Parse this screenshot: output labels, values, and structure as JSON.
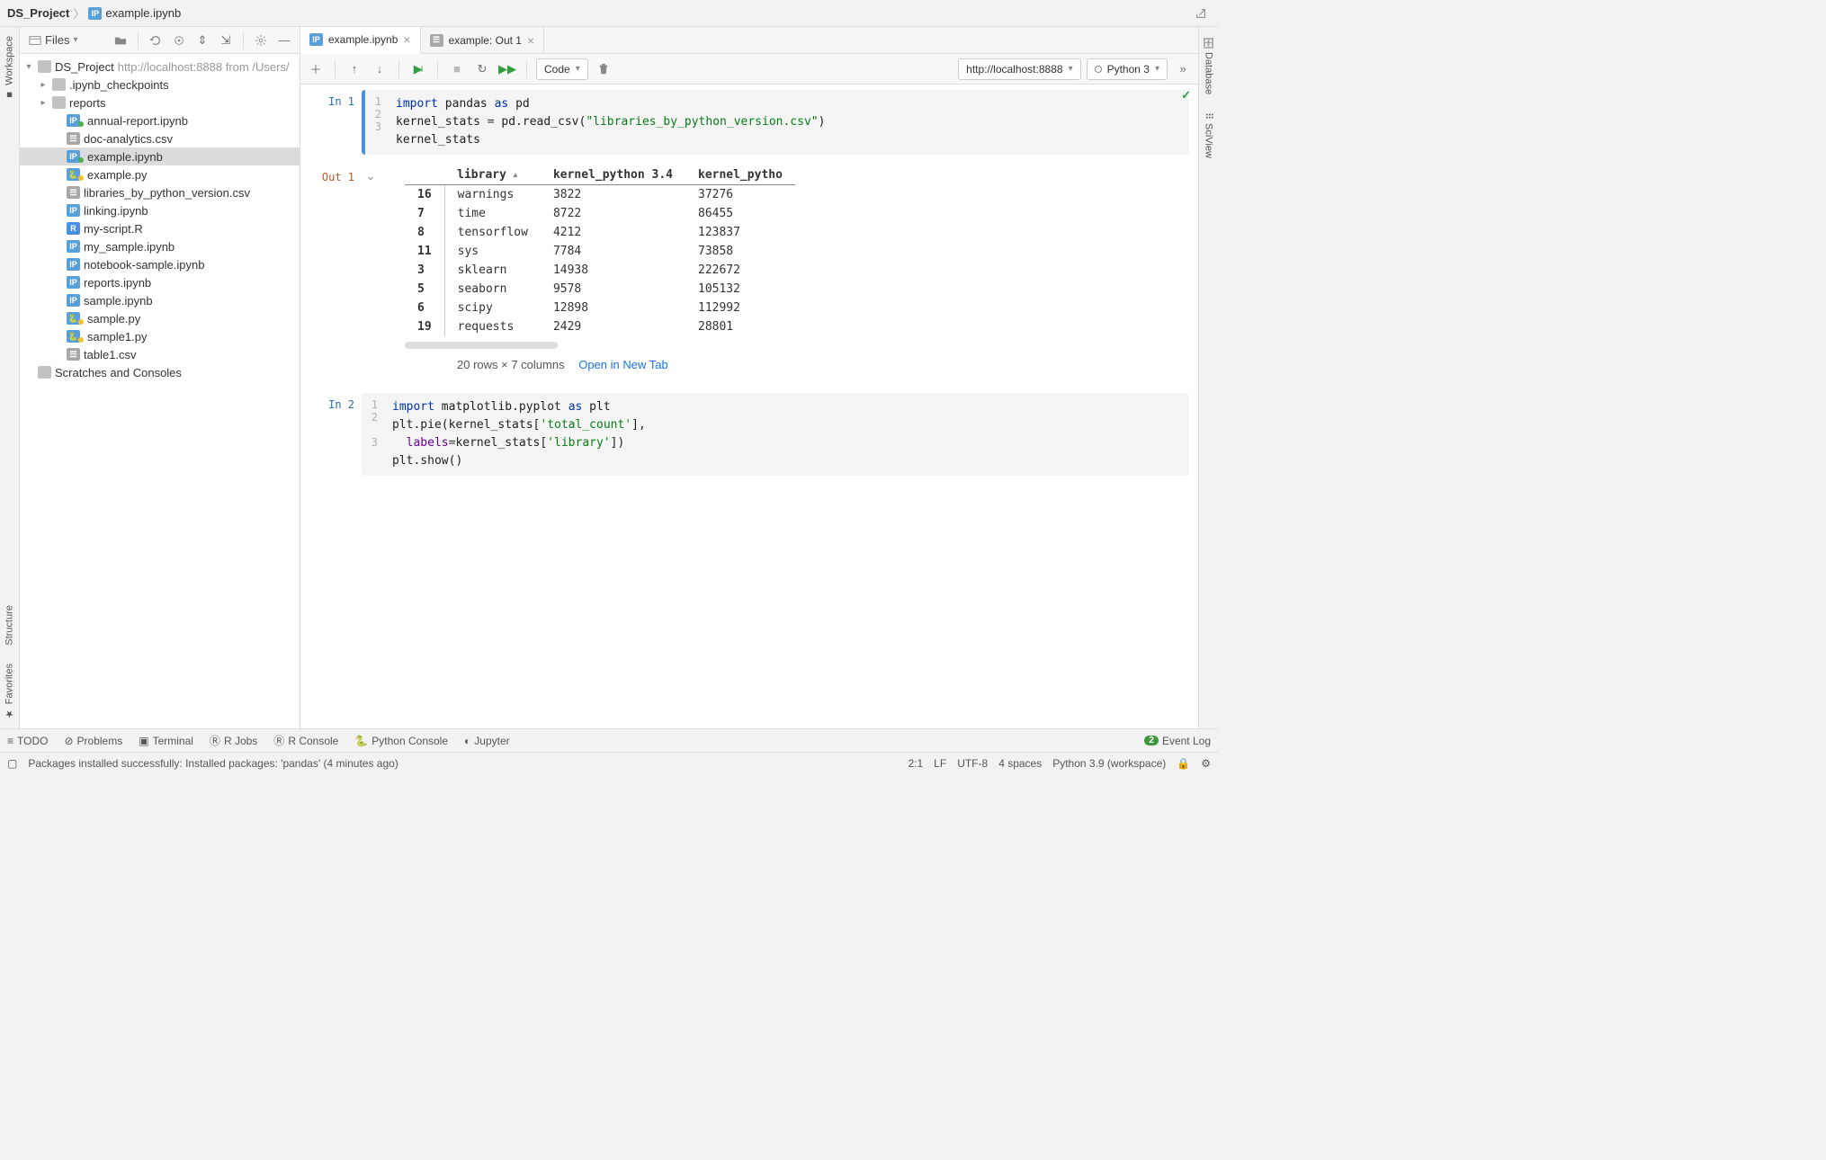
{
  "breadcrumb": {
    "project": "DS_Project",
    "file": "example.ipynb"
  },
  "sidebar": {
    "selector": "Files",
    "root": {
      "name": "DS_Project",
      "hint": "http://localhost:8888 from /Users/"
    },
    "folders": [
      ".ipynb_checkpoints",
      "reports"
    ],
    "files": [
      {
        "name": "annual-report.ipynb",
        "type": "ipynb",
        "dot": "green"
      },
      {
        "name": "doc-analytics.csv",
        "type": "csv"
      },
      {
        "name": "example.ipynb",
        "type": "ipynb",
        "dot": "green",
        "selected": true
      },
      {
        "name": "example.py",
        "type": "py",
        "dot": "yellow"
      },
      {
        "name": "libraries_by_python_version.csv",
        "type": "csv"
      },
      {
        "name": "linking.ipynb",
        "type": "ipynb"
      },
      {
        "name": "my-script.R",
        "type": "r"
      },
      {
        "name": "my_sample.ipynb",
        "type": "ipynb"
      },
      {
        "name": "notebook-sample.ipynb",
        "type": "ipynb"
      },
      {
        "name": "reports.ipynb",
        "type": "ipynb"
      },
      {
        "name": "sample.ipynb",
        "type": "ipynb"
      },
      {
        "name": "sample.py",
        "type": "py",
        "dot": "yellow"
      },
      {
        "name": "sample1.py",
        "type": "py",
        "dot": "yellow"
      },
      {
        "name": "table1.csv",
        "type": "csv"
      }
    ],
    "scratches": "Scratches and Consoles"
  },
  "left_tabs": [
    "Workspace",
    "Structure",
    "Favorites"
  ],
  "right_tabs": [
    "Database",
    "SciView"
  ],
  "tabs": [
    {
      "label": "example.ipynb",
      "active": true,
      "kind": "ipynb"
    },
    {
      "label": "example: Out 1",
      "active": false,
      "kind": "table"
    }
  ],
  "toolbar": {
    "cell_type": "Code",
    "server": "http://localhost:8888",
    "kernel": "Python 3"
  },
  "cells": {
    "in1": {
      "prompt": "In 1",
      "lines": [
        "1",
        "2",
        "3"
      ],
      "code_tokens": [
        [
          [
            "kw",
            "import"
          ],
          [
            "sp",
            " "
          ],
          [
            "nm",
            "pandas"
          ],
          [
            "sp",
            " "
          ],
          [
            "kw",
            "as"
          ],
          [
            "sp",
            " "
          ],
          [
            "nm",
            "pd"
          ]
        ],
        [
          [
            "nm",
            "kernel_stats"
          ],
          [
            "sp",
            " "
          ],
          [
            "op",
            "="
          ],
          [
            "sp",
            " "
          ],
          [
            "nm",
            "pd.read_csv("
          ],
          [
            "str",
            "\"libraries_by_python_version.csv\""
          ],
          [
            "nm",
            ")"
          ]
        ],
        [
          [
            "nm",
            "kernel_stats"
          ]
        ]
      ]
    },
    "out1": {
      "prompt": "Out 1",
      "summary": "20 rows × 7 columns",
      "open_link": "Open in New Tab",
      "columns": [
        "library",
        "kernel_python 3.4",
        "kernel_pytho"
      ],
      "rows": [
        {
          "idx": "16",
          "c": [
            "warnings",
            "3822",
            "37276"
          ]
        },
        {
          "idx": "7",
          "c": [
            "time",
            "8722",
            "86455"
          ]
        },
        {
          "idx": "8",
          "c": [
            "tensorflow",
            "4212",
            "123837"
          ]
        },
        {
          "idx": "11",
          "c": [
            "sys",
            "7784",
            "73858"
          ]
        },
        {
          "idx": "3",
          "c": [
            "sklearn",
            "14938",
            "222672"
          ]
        },
        {
          "idx": "5",
          "c": [
            "seaborn",
            "9578",
            "105132"
          ]
        },
        {
          "idx": "6",
          "c": [
            "scipy",
            "12898",
            "112992"
          ]
        },
        {
          "idx": "19",
          "c": [
            "requests",
            "2429",
            "28801"
          ]
        }
      ]
    },
    "in2": {
      "prompt": "In 2",
      "lines": [
        "1",
        "2",
        "",
        "3"
      ],
      "code_tokens": [
        [
          [
            "kw",
            "import"
          ],
          [
            "sp",
            " "
          ],
          [
            "nm",
            "matplotlib.pyplot"
          ],
          [
            "sp",
            " "
          ],
          [
            "kw",
            "as"
          ],
          [
            "sp",
            " "
          ],
          [
            "nm",
            "plt"
          ]
        ],
        [
          [
            "nm",
            "plt.pie(kernel_stats["
          ],
          [
            "str",
            "'total_count'"
          ],
          [
            "nm",
            "],"
          ]
        ],
        [
          [
            "sp",
            "  "
          ],
          [
            "param",
            "labels"
          ],
          [
            "op",
            "="
          ],
          [
            "nm",
            "kernel_stats["
          ],
          [
            "str",
            "'library'"
          ],
          [
            "nm",
            "])"
          ]
        ],
        [
          [
            "nm",
            "plt.show()"
          ]
        ]
      ]
    }
  },
  "bottom_tools": [
    "TODO",
    "Problems",
    "Terminal",
    "R Jobs",
    "R Console",
    "Python Console",
    "Jupyter"
  ],
  "event_log": {
    "count": "2",
    "label": "Event Log"
  },
  "status": {
    "message": "Packages installed successfully: Installed packages: 'pandas' (4 minutes ago)",
    "pos": "2:1",
    "eol": "LF",
    "enc": "UTF-8",
    "indent": "4 spaces",
    "interp": "Python 3.9 (workspace)"
  }
}
